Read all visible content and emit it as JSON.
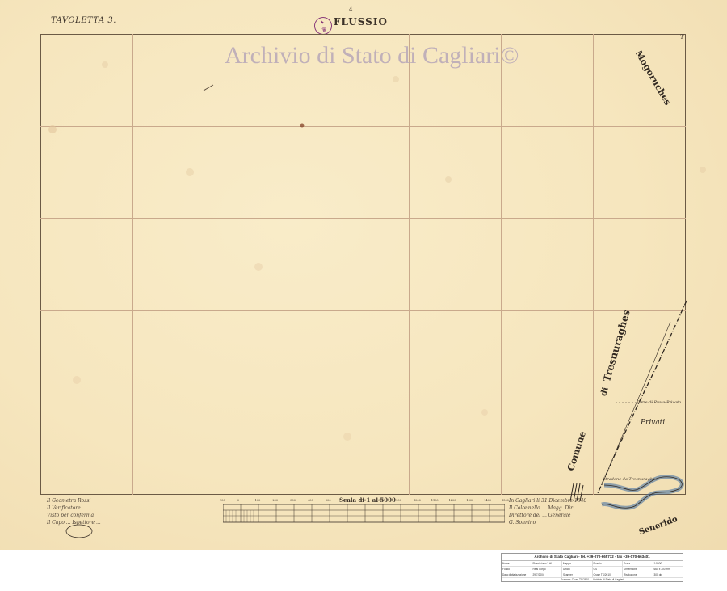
{
  "header": {
    "tavoletta": "TAVOLETTA  3.",
    "sheet_number": "4",
    "title": "FLUSSIO",
    "seal_text": "Archivio di Stato Cagliari"
  },
  "watermark": "Archivio di Stato di Cagliari©",
  "places": {
    "top_right": "Mogoruches",
    "comune": "Comune",
    "di": "di",
    "tresnuraghes": "Tresnuraghes",
    "privati": "Privati",
    "bottom_right": "Senerido",
    "ter_note": "Terre di Prato Privato",
    "stradone_note": "Stradone da Tresnuraghes",
    "corner_mark": "T"
  },
  "scale": {
    "title": "Scala  di 1 al 5000",
    "ticks": [
      "100",
      "0",
      "100",
      "200",
      "300",
      "400",
      "500",
      "600",
      "700",
      "800",
      "900",
      "1000",
      "1100",
      "1200",
      "1300",
      "1400",
      "1500"
    ]
  },
  "signatures": {
    "left": [
      "Il Geometra Rossi",
      "Il Verificatore ...",
      "Visto per conferma",
      "Il Capo ... Ispettore ..."
    ],
    "right": [
      "In Cagliari li 31 Dicembre 1848",
      "Il Colonnello ... Magg. Dir.",
      "Direttore del ... Generale",
      "G. Sonnino"
    ]
  },
  "footer": {
    "title": "Archivio di Stato Cagliari - tel. +39-070-665772 - fax +39-070-663401",
    "rows": [
      [
        "Nome",
        "Flussio.tavo.3.tif",
        "Mappa",
        "Flussio",
        "Scala",
        "1:5000"
      ],
      [
        "Fondo",
        "Real Corpo",
        "Ufficio",
        "GS",
        "Dimensione",
        "660 x 700 mm"
      ],
      [
        "Data digitalizzazione",
        "29/7/2004",
        "Scanner",
        "Cruse TS/2610",
        "Risoluzione",
        "300 dpi"
      ]
    ],
    "note": "Scanner: Cruse TS/2610 — Archivio di Stato di Cagliari"
  }
}
